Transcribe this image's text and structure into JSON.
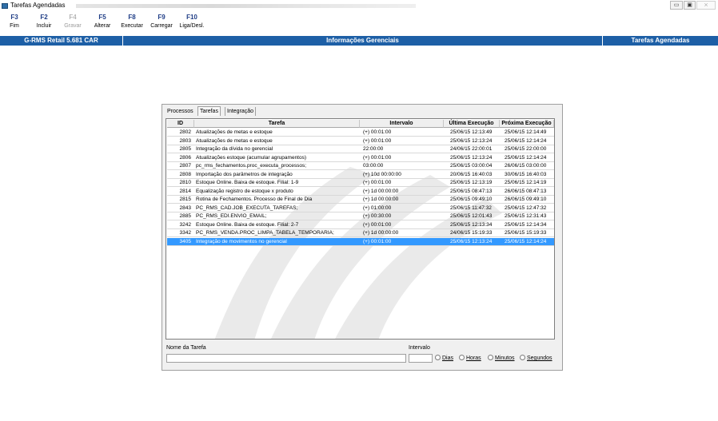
{
  "window": {
    "title": "Tarefas Agendadas",
    "controls": {
      "minimize": "▭",
      "restore": "▣",
      "close": "⨯"
    }
  },
  "toolbar": [
    {
      "key": "F3",
      "label": "Fim",
      "enabled": true
    },
    {
      "key": "F2",
      "label": "Incluir",
      "enabled": true
    },
    {
      "key": "F4",
      "label": "Gravar",
      "enabled": false
    },
    {
      "key": "F5",
      "label": "Alterar",
      "enabled": true
    },
    {
      "key": "F8",
      "label": "Executar",
      "enabled": true
    },
    {
      "key": "F9",
      "label": "Carregar",
      "enabled": true
    },
    {
      "key": "F10",
      "label": "Liga/Desl.",
      "enabled": true
    }
  ],
  "header_bar": {
    "product": "G-RMS Retail 5.681 CAR",
    "module": "Informações Gerenciais",
    "screen": "Tarefas Agendadas",
    "color": "#1d5fa6"
  },
  "tabs": [
    {
      "label": "Processos",
      "active": false
    },
    {
      "label": "Tarefas",
      "active": true
    },
    {
      "label": "Integração",
      "active": false
    }
  ],
  "grid": {
    "columns": [
      "ID",
      "Tarefa",
      "Intervalo",
      "Última Execução",
      "Próxima Execução"
    ],
    "selected_color": "#3399ff",
    "rows": [
      {
        "id": "2802",
        "tarefa": "Atualizações de metas e estoque",
        "intervalo": "(+) 00:01:00",
        "ultima": "25/06/15 12:13:49",
        "proxima": "25/06/15 12:14:49",
        "selected": false
      },
      {
        "id": "2803",
        "tarefa": "Atualizações de metas e estoque",
        "intervalo": "(+) 00:01:00",
        "ultima": "25/06/15 12:13:24",
        "proxima": "25/06/15 12:14:24",
        "selected": false
      },
      {
        "id": "2805",
        "tarefa": "Integração da dívida no gerencial",
        "intervalo": "22:00:00",
        "ultima": "24/06/15 22:00:01",
        "proxima": "25/06/15 22:00:00",
        "selected": false
      },
      {
        "id": "2806",
        "tarefa": "Atualizações estoque (acumular agrupamentos)",
        "intervalo": "(+) 00:01:00",
        "ultima": "25/06/15 12:13:24",
        "proxima": "25/06/15 12:14:24",
        "selected": false
      },
      {
        "id": "2807",
        "tarefa": "pc_rms_fechamentos.proc_executa_processos;",
        "intervalo": "03:00:00",
        "ultima": "25/06/15 03:00:04",
        "proxima": "26/06/15 03:00:00",
        "selected": false
      },
      {
        "id": "2808",
        "tarefa": "Importação dos parâmetros de integração",
        "intervalo": "(+) 10d 00:00:00",
        "ultima": "20/06/15 16:40:03",
        "proxima": "30/06/15 16:40:03",
        "selected": false
      },
      {
        "id": "2810",
        "tarefa": "Estoque Online. Baixa de estoque. Filial: 1-9",
        "intervalo": "(+) 00:01:00",
        "ultima": "25/06/15 12:13:19",
        "proxima": "25/06/15 12:14:19",
        "selected": false
      },
      {
        "id": "2814",
        "tarefa": "Equalização registro de estoque x produto",
        "intervalo": "(+) 1d 00:00:00",
        "ultima": "25/06/15 08:47:13",
        "proxima": "26/06/15 08:47:13",
        "selected": false
      },
      {
        "id": "2815",
        "tarefa": "Rotina de Fechamentos. Processo de Final de Dia",
        "intervalo": "(+) 1d 00:00:00",
        "ultima": "25/06/15 09:49:10",
        "proxima": "26/06/15 09:49:10",
        "selected": false
      },
      {
        "id": "2843",
        "tarefa": "PC_RMS_CAD.JOB_EXECUTA_TAREFAS;",
        "intervalo": "(+) 01:00:00",
        "ultima": "25/06/15 11:47:32",
        "proxima": "25/06/15 12:47:32",
        "selected": false
      },
      {
        "id": "2885",
        "tarefa": "PC_RMS_EDI.ENVIO_EMAIL;",
        "intervalo": "(+) 00:30:00",
        "ultima": "25/06/15 12:01:43",
        "proxima": "25/06/15 12:31:43",
        "selected": false
      },
      {
        "id": "3242",
        "tarefa": "Estoque Online. Baixa de estoque. Filial: 2-7",
        "intervalo": "(+) 00:01:00",
        "ultima": "25/06/15 12:13:34",
        "proxima": "25/06/15 12:14:34",
        "selected": false
      },
      {
        "id": "3342",
        "tarefa": "PC_RMS_VENDA.PROC_LIMPA_TABELA_TEMPORARIA;",
        "intervalo": "(+) 1d 00:00:00",
        "ultima": "24/06/15 15:19:33",
        "proxima": "25/06/15 15:19:33",
        "selected": false
      },
      {
        "id": "3405",
        "tarefa": "Integração de movimentos no gerencial",
        "intervalo": "(+) 00:01:00",
        "ultima": "25/06/15 12:13:24",
        "proxima": "25/06/15 12:14:24",
        "selected": true
      }
    ]
  },
  "form": {
    "nome_label": "Nome da Tarefa",
    "nome_value": "",
    "intervalo_label": "Intervalo",
    "intervalo_value": "",
    "options": [
      "Dias",
      "Horas",
      "Minutos",
      "Segundos"
    ]
  }
}
